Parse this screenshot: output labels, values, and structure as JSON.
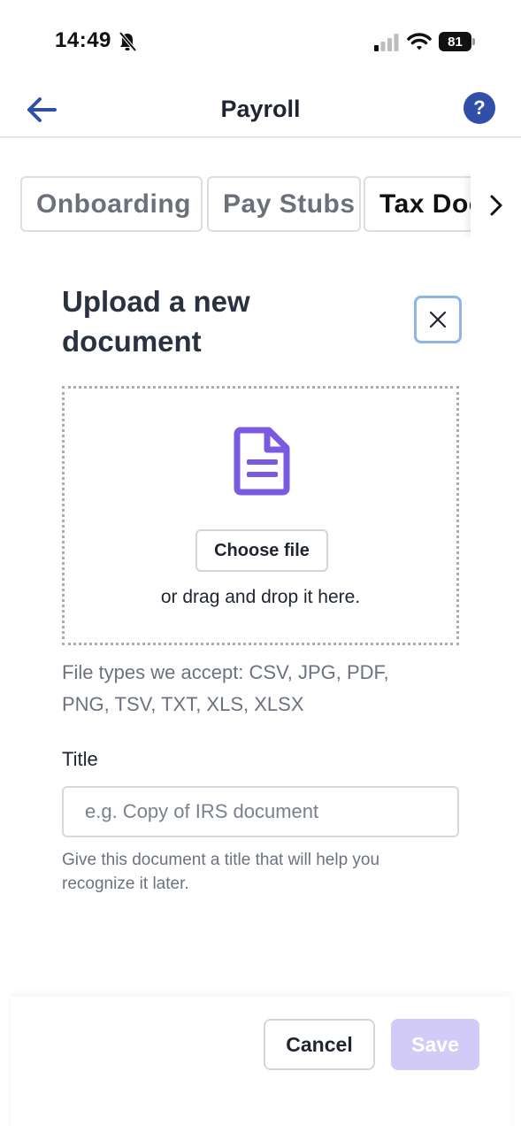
{
  "status_bar": {
    "time": "14:49",
    "battery": "81"
  },
  "header": {
    "title": "Payroll",
    "help_label": "?"
  },
  "tabs": [
    {
      "label": "Onboarding",
      "active": false
    },
    {
      "label": "Pay Stubs",
      "active": false
    },
    {
      "label": "Tax Documents",
      "active": true
    }
  ],
  "upload": {
    "heading_line1": "Upload a new",
    "heading_line2": "document",
    "choose_file_label": "Choose file",
    "drag_text": "or drag and drop it here.",
    "file_types_line1": "File types we accept: CSV, JPG, PDF,",
    "file_types_line2": "PNG, TSV, TXT, XLS, XLSX"
  },
  "title_field": {
    "label": "Title",
    "value": "",
    "placeholder": "e.g. Copy of IRS document",
    "help_line1": "Give this document a title that will help you",
    "help_line2": "recognize it later."
  },
  "footer": {
    "cancel_label": "Cancel",
    "save_label": "Save"
  },
  "colors": {
    "accent": "#2f4fa8",
    "doc_icon": "#7a5ae0",
    "save_disabled": "#d3cbf7",
    "close_border": "#8fb4e6"
  },
  "icons": {
    "back": "arrow-left-icon",
    "help": "question-circle-icon",
    "tab_next": "chevron-right-icon",
    "close": "close-icon",
    "document": "document-icon",
    "bell_off": "bell-slash-icon",
    "signal": "signal-icon",
    "wifi": "wifi-icon",
    "battery": "battery-icon"
  }
}
